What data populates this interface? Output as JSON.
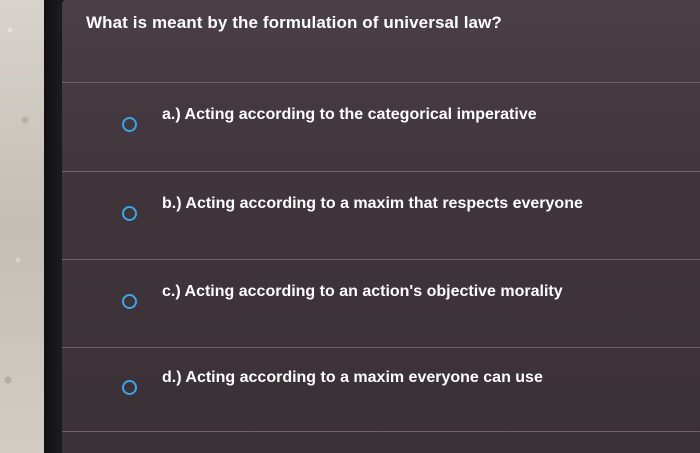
{
  "question": "What is meant by the formulation of universal law?",
  "options": [
    {
      "label": "a.) Acting according to the categorical imperative",
      "selected": false
    },
    {
      "label": "b.) Acting according to a maxim that respects everyone",
      "selected": false
    },
    {
      "label": "c.) Acting according to an action's objective morality",
      "selected": false
    },
    {
      "label": "d.) Acting according to a maxim everyone can use",
      "selected": false
    }
  ],
  "colors": {
    "screen_background": "#3f353b",
    "radio_accent": "#3aa6ec",
    "text": "#ffffff"
  },
  "icons": {
    "radio": "radio-unselected-icon"
  }
}
